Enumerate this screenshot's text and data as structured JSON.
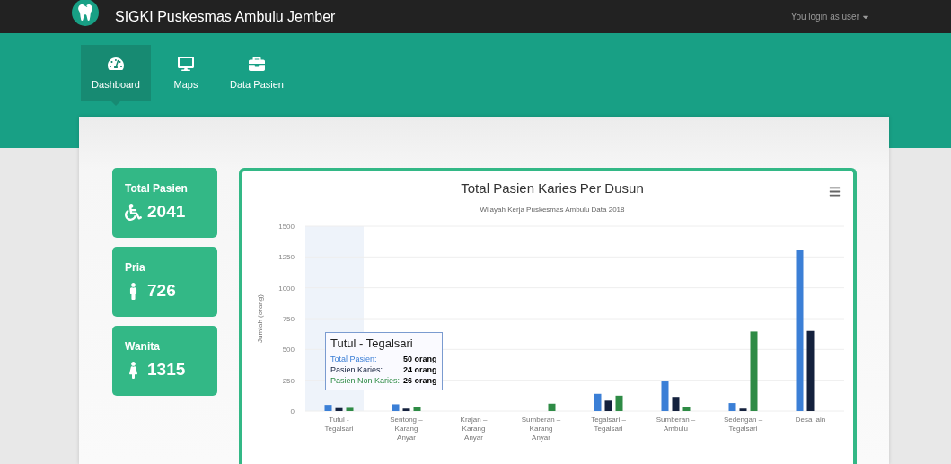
{
  "topbar": {
    "brand": "SIGKI Puskesmas Ambulu Jember",
    "user_menu": "You login as user"
  },
  "nav": [
    {
      "label": "Dashboard",
      "selected": true
    },
    {
      "label": "Maps",
      "selected": false
    },
    {
      "label": "Data Pasien",
      "selected": false
    }
  ],
  "stats": [
    {
      "label": "Total Pasien",
      "value": "2041"
    },
    {
      "label": "Pria",
      "value": "726"
    },
    {
      "label": "Wanita",
      "value": "1315"
    }
  ],
  "chart": {
    "chart_data": {
      "type": "bar",
      "title": "Total Pasien Karies Per Dusun",
      "subtitle": "Wilayah Kerja Puskesmas Ambulu Data 2018",
      "ylabel": "Jumlah (orang)",
      "grid": true,
      "categories": [
        "Tutul - Tegalsari",
        "Sentong – Karang Anyar",
        "Krajan – Karang Anyar",
        "Sumberan – Karang Anyar",
        "Tegalsari – Tegalsari",
        "Sumberan – Ambulu",
        "Sedengan – Tegalsari",
        "Desa lain"
      ],
      "series": [
        {
          "color": "#3b7fd6",
          "values": [
            50,
            55,
            0,
            0,
            140,
            240,
            65,
            1310
          ]
        },
        {
          "color": "#14213d",
          "values": [
            24,
            20,
            0,
            0,
            85,
            115,
            20,
            650
          ]
        },
        {
          "color": "#2e8b45",
          "values": [
            26,
            35,
            0,
            60,
            125,
            30,
            645,
            0
          ]
        }
      ],
      "ylim": [
        0,
        1500
      ],
      "yticks": [
        0,
        250,
        500,
        750,
        1000,
        1250,
        1500
      ]
    },
    "tooltip": {
      "title": "Tutul - Tegalsari",
      "rows": [
        {
          "label": "Total Pasien:",
          "value": "50 orang"
        },
        {
          "label": "Pasien Karies:",
          "value": "24 orang"
        },
        {
          "label": "Pasien Non Karies:",
          "value": "26 orang"
        }
      ]
    }
  }
}
